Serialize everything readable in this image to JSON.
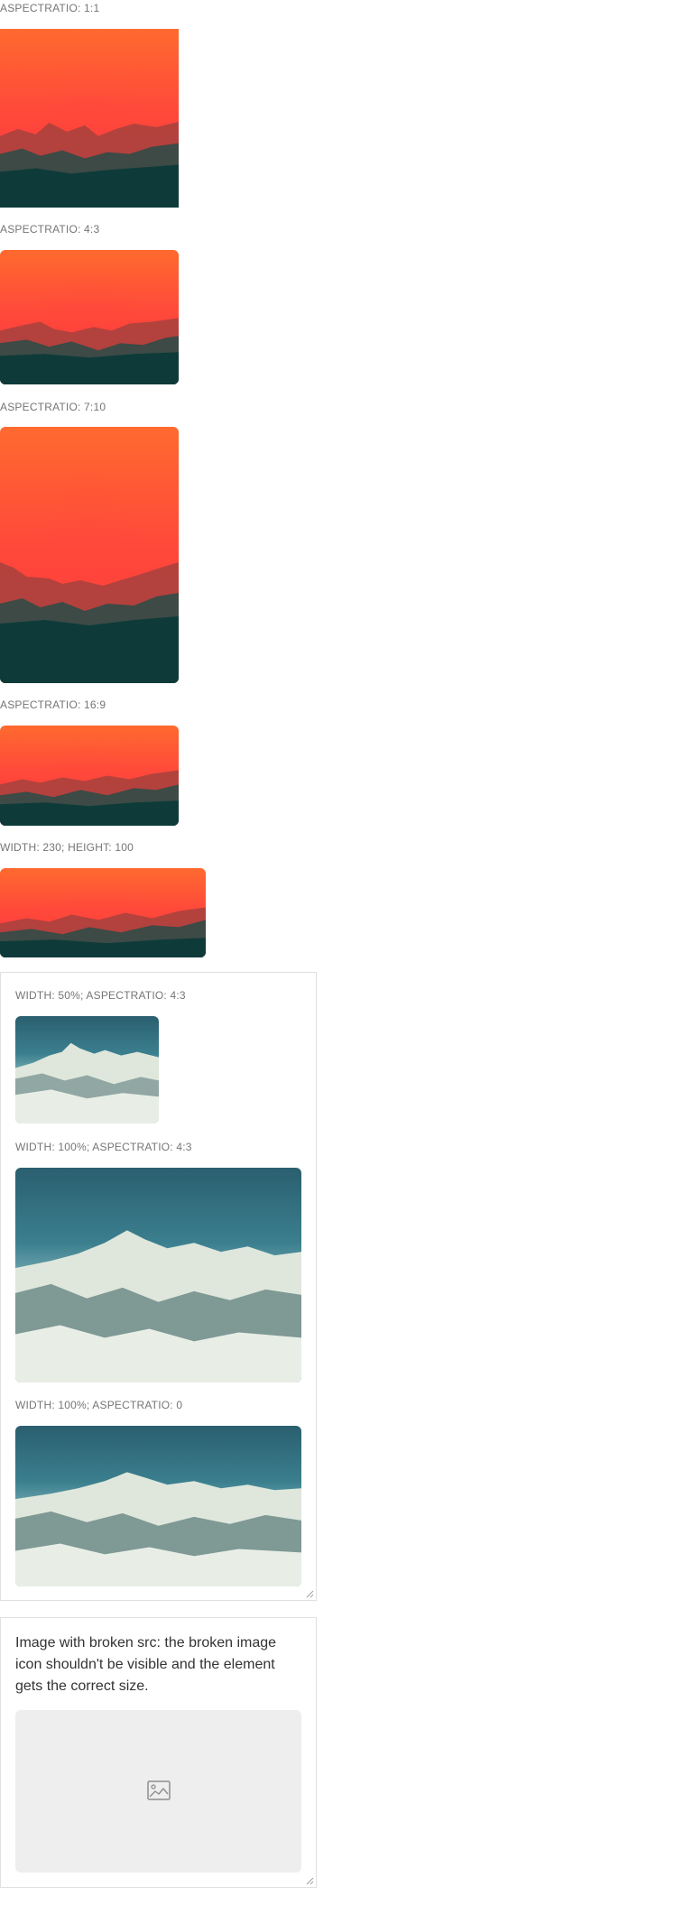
{
  "sections": [
    {
      "label": "ASPECTRATIO: 1:1"
    },
    {
      "label": "ASPECTRATIO: 4:3"
    },
    {
      "label": "ASPECTRATIO: 7:10"
    },
    {
      "label": "ASPECTRATIO: 16:9"
    },
    {
      "label": "WIDTH: 230; HEIGHT: 100"
    }
  ],
  "panel": {
    "items": [
      {
        "label": "WIDTH: 50%; ASPECTRATIO: 4:3"
      },
      {
        "label": "WIDTH: 100%; ASPECTRATIO: 4:3"
      },
      {
        "label": "WIDTH: 100%; ASPECTRATIO: 0"
      }
    ]
  },
  "broken": {
    "text": "Image with broken src: the broken image icon shouldn't be visible and the element gets the correct size.",
    "icon": "broken-image-icon"
  },
  "colors": {
    "sunset_top": "#ff6a2f",
    "sunset_bottom": "#e8463f",
    "mountain_near": "#0e3b3a",
    "placeholder_bg": "#eeeeee"
  }
}
